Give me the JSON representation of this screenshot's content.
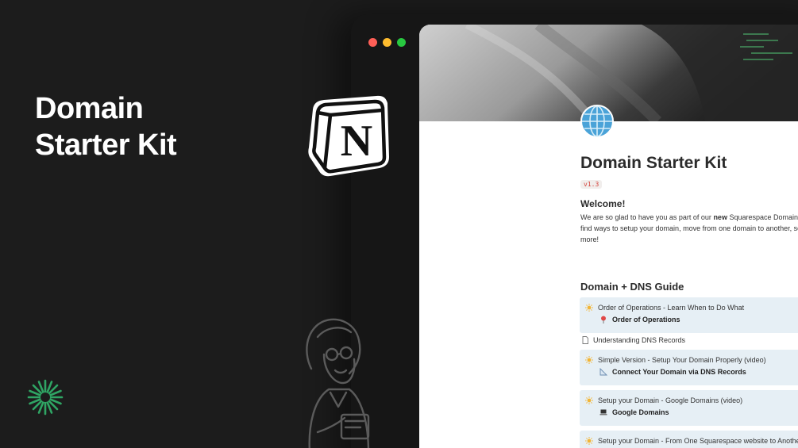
{
  "promo": {
    "title_line1": "Domain",
    "title_line2": "Starter Kit"
  },
  "brand": {
    "logo_letter": "N",
    "accent": "#2fa564"
  },
  "window": {
    "traffic_lights": [
      "#ff5f57",
      "#febc2e",
      "#28c840"
    ]
  },
  "page": {
    "icon": "globe-icon",
    "title": "Domain Starter Kit",
    "version": "v1.3",
    "welcome_heading": "Welcome!",
    "welcome_line1_pre": "We are so glad to have you as part of our ",
    "welcome_line1_bold": "new",
    "welcome_line1_post": " Squarespace Domain Star",
    "welcome_line2": "find ways to setup your domain, move from one domain to another, setu",
    "welcome_line3": "more!",
    "section_heading": "Domain + DNS Guide",
    "items": [
      {
        "title": "Order of Operations - Learn When to Do What",
        "sub": "Order of Operations",
        "icon": "sun-icon",
        "sub_icon": "pin-icon"
      },
      {
        "title": "Understanding DNS Records",
        "icon": "page-icon"
      },
      {
        "title": "Simple Version - Setup Your Domain Properly (video)",
        "sub": "Connect Your Domain via DNS Records",
        "icon": "sun-icon",
        "sub_icon": "triangle-ruler-icon"
      },
      {
        "title": "Setup your Domain - Google Domains (video)",
        "sub": "Google Domains",
        "icon": "sun-icon",
        "sub_icon": "laptop-icon"
      },
      {
        "title": "Setup your Domain - From One Squarespace website to Another (v",
        "icon": "sun-icon"
      }
    ]
  }
}
